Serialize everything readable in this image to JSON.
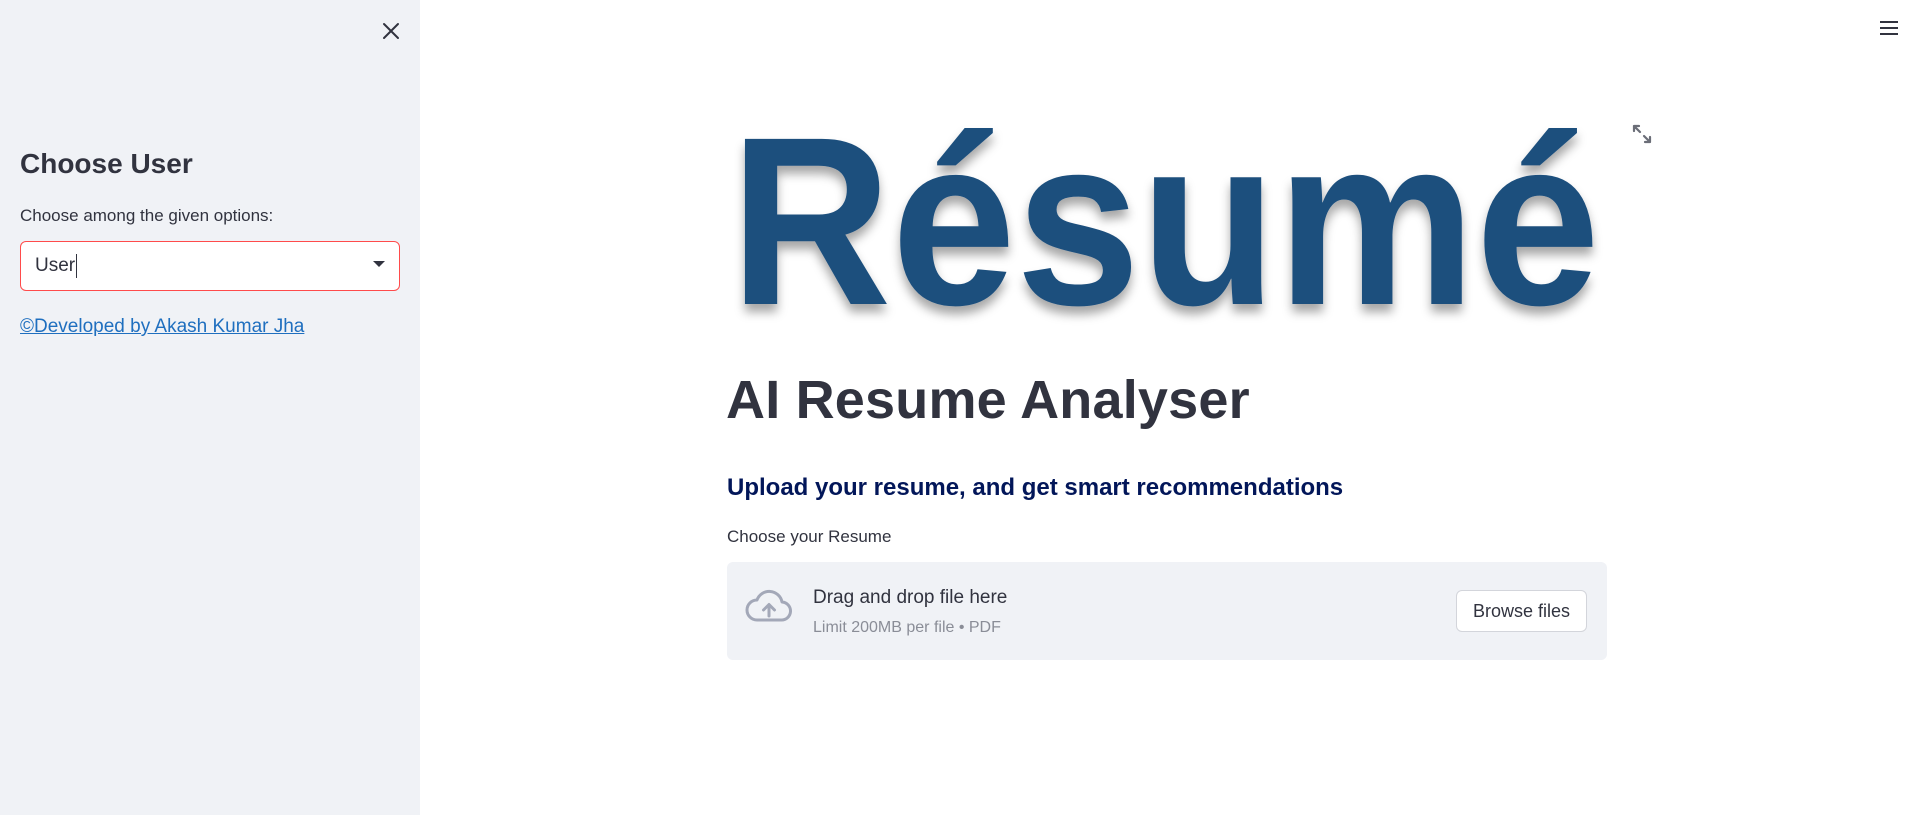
{
  "sidebar": {
    "title": "Choose User",
    "select_label": "Choose among the given options:",
    "select_value": "User",
    "footer_link": "©Developed by Akash Kumar Jha"
  },
  "main": {
    "hero_text": "Résumé",
    "title": "AI Resume Analyser",
    "subheading": "Upload your resume, and get smart recommendations",
    "uploader": {
      "label": "Choose your Resume",
      "drop_text": "Drag and drop file here",
      "limit_text": "Limit 200MB per file • PDF",
      "button_label": "Browse files"
    }
  },
  "colors": {
    "accent": "#ff4b4b",
    "hero_blue": "#1f4f7d",
    "subheading": "#021659",
    "sidebar_bg": "#f0f2f6",
    "link": "#1f6fbf"
  }
}
